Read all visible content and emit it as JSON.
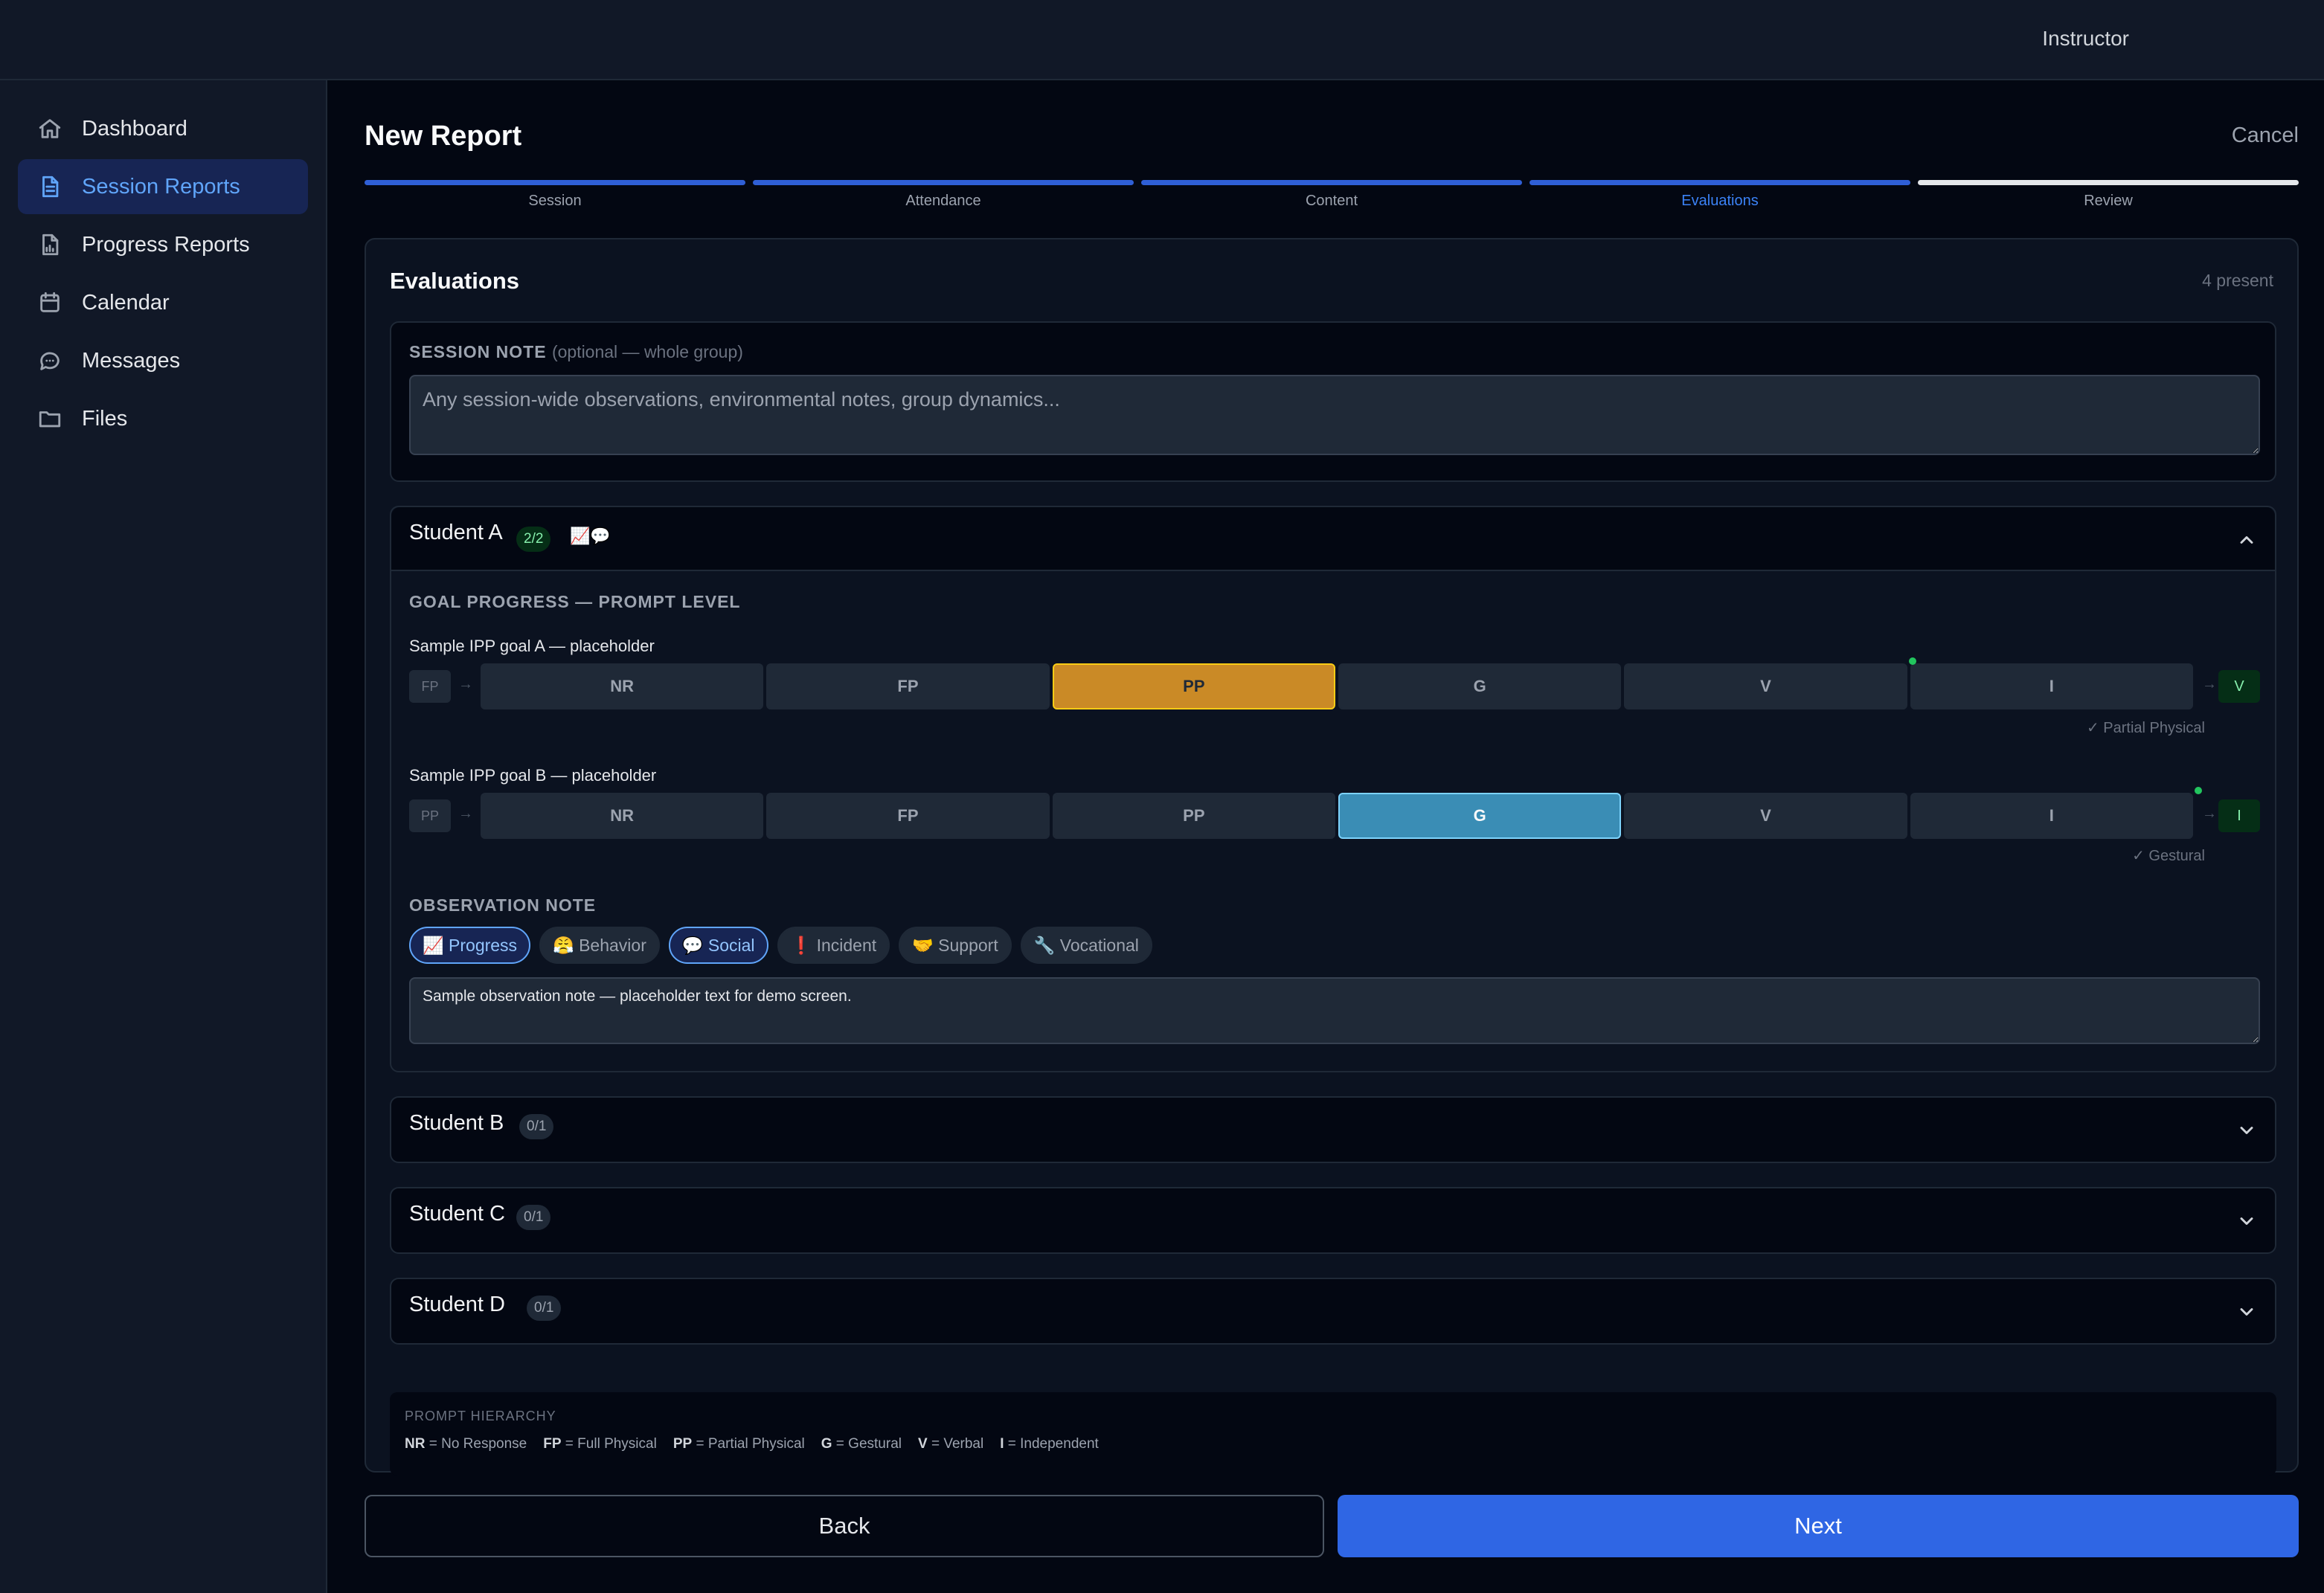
{
  "topbar": {
    "user": "Instructor"
  },
  "sidebar": {
    "items": [
      {
        "label": "Dashboard",
        "icon": "home-icon"
      },
      {
        "label": "Session Reports",
        "icon": "document-icon",
        "active": true
      },
      {
        "label": "Progress Reports",
        "icon": "report-chart-icon"
      },
      {
        "label": "Calendar",
        "icon": "calendar-icon"
      },
      {
        "label": "Messages",
        "icon": "chat-bubble-icon"
      },
      {
        "label": "Files",
        "icon": "folder-icon"
      }
    ]
  },
  "header": {
    "title": "New Report",
    "cancel": "Cancel"
  },
  "stepper": {
    "steps": [
      {
        "label": "Session",
        "state": "done"
      },
      {
        "label": "Attendance",
        "state": "done"
      },
      {
        "label": "Content",
        "state": "done"
      },
      {
        "label": "Evaluations",
        "state": "current"
      },
      {
        "label": "Review",
        "state": "pending"
      }
    ]
  },
  "evaluations": {
    "title": "Evaluations",
    "present": "4 present",
    "session_note": {
      "label": "SESSION NOTE",
      "optional": "(optional — whole group)",
      "placeholder": "Any session-wide observations, environmental notes, group dynamics..."
    },
    "students": [
      {
        "name": "Student A",
        "badge": "2/2",
        "icons": "📈💬",
        "expanded": true,
        "goal_section_label": "GOAL PROGRESS — PROMPT LEVEL",
        "goals": [
          {
            "label": "Sample IPP goal A — placeholder",
            "current": "FP",
            "target": "V",
            "selected": "PP",
            "check": "✓ Partial Physical"
          },
          {
            "label": "Sample IPP goal B — placeholder",
            "current": "PP",
            "target": "I",
            "selected": "G",
            "check": "✓ Gestural"
          }
        ],
        "observation": {
          "label": "OBSERVATION NOTE",
          "chips": [
            {
              "label": "📈 Progress",
              "on": true
            },
            {
              "label": "😤 Behavior",
              "on": false
            },
            {
              "label": "💬 Social",
              "on": true
            },
            {
              "label": "❗ Incident",
              "on": false
            },
            {
              "label": "🤝 Support",
              "on": false
            },
            {
              "label": "🔧 Vocational",
              "on": false
            }
          ],
          "note": "Sample observation note — placeholder text for demo screen."
        }
      },
      {
        "name": "Student B",
        "badge": "0/1",
        "expanded": false
      },
      {
        "name": "Student C",
        "badge": "0/1",
        "expanded": false
      },
      {
        "name": "Student D",
        "badge": "0/1",
        "expanded": false
      }
    ],
    "levels": [
      "NR",
      "FP",
      "PP",
      "G",
      "V",
      "I"
    ],
    "legend": {
      "title": "PROMPT HIERARCHY",
      "items": [
        {
          "abbr": "NR",
          "desc": "= No Response"
        },
        {
          "abbr": "FP",
          "desc": "= Full Physical"
        },
        {
          "abbr": "PP",
          "desc": "= Partial Physical"
        },
        {
          "abbr": "G",
          "desc": "= Gestural"
        },
        {
          "abbr": "V",
          "desc": "= Verbal"
        },
        {
          "abbr": "I",
          "desc": "= Independent"
        }
      ]
    }
  },
  "footer": {
    "back": "Back",
    "next": "Next"
  },
  "colors": {
    "accent": "#2f66e4",
    "pp_selected": "#ca8a26",
    "g_selected": "#3a8db5",
    "target_green": "#86efac"
  }
}
